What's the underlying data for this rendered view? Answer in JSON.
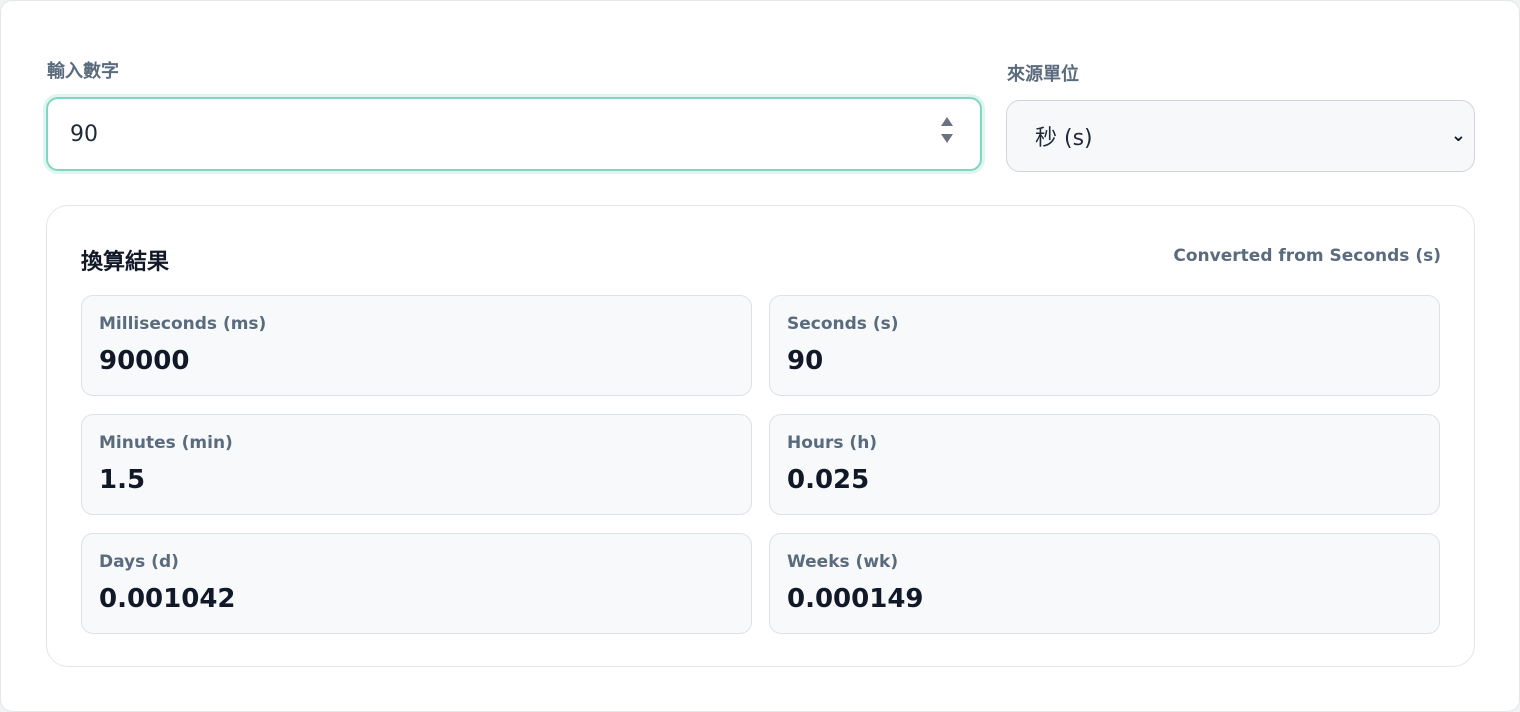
{
  "input": {
    "label": "輸入數字",
    "value": "90"
  },
  "unit": {
    "label": "來源單位",
    "selected": "秒 (s)"
  },
  "results": {
    "title": "換算結果",
    "note": "Converted from Seconds (s)",
    "items": [
      {
        "label": "Milliseconds (ms)",
        "value": "90000"
      },
      {
        "label": "Seconds (s)",
        "value": "90"
      },
      {
        "label": "Minutes (min)",
        "value": "1.5"
      },
      {
        "label": "Hours (h)",
        "value": "0.025"
      },
      {
        "label": "Days (d)",
        "value": "0.001042"
      },
      {
        "label": "Weeks (wk)",
        "value": "0.000149"
      }
    ]
  },
  "colors": {
    "focus_border": "#80d6c0",
    "label_text": "#5b6b7e",
    "tile_bg": "#f7f9fb"
  },
  "icons": {
    "spinner": "up-down-arrows-icon",
    "select": "chevron-down-icon"
  }
}
